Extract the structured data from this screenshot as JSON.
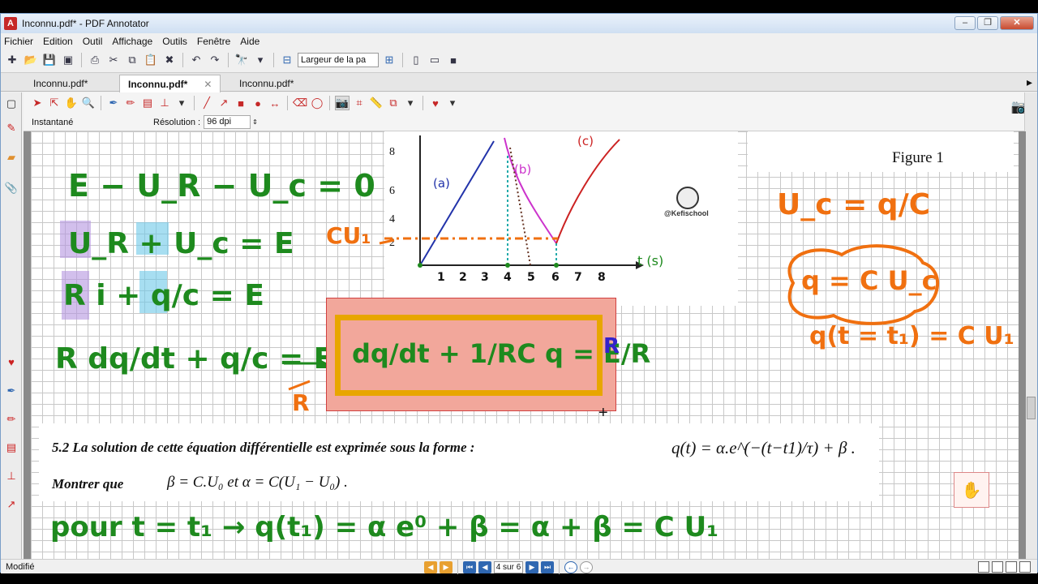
{
  "window": {
    "title": "Inconnu.pdf* - PDF Annotator",
    "app_icon": "pdf-annotator-icon"
  },
  "menu": [
    "Fichier",
    "Edition",
    "Outil",
    "Affichage",
    "Outils",
    "Fenêtre",
    "Aide"
  ],
  "toolbar": {
    "zoom_value": "Largeur de la pa"
  },
  "tabs": [
    {
      "label": "Inconnu.pdf*",
      "active": false
    },
    {
      "label": "Inconnu.pdf*",
      "active": true
    },
    {
      "label": "Inconnu.pdf*",
      "active": false
    }
  ],
  "tool_options": {
    "tool_name": "Instantané",
    "resolution_label": "Résolution :",
    "resolution_value": "96 dpi"
  },
  "document": {
    "figure_label": "Figure 1",
    "watermark": "@Kefischool",
    "graph_ticks_x": [
      "1",
      "2",
      "3",
      "4",
      "5",
      "6",
      "7",
      "8"
    ],
    "graph_ticks_y": [
      "8",
      "6",
      "4",
      "2"
    ],
    "graph_axis_label": "t (s)",
    "graph_curve_labels": [
      "(a)",
      "(b)",
      "(c)"
    ],
    "question_5_2_intro": "5.2 La solution de cette équation différentielle est exprimée sous la forme :",
    "question_5_2_formula": "q(t) = α.e^(−(t−t1)/τ) + β .",
    "question_5_2_task_prefix": "Montrer que",
    "question_5_2_task_formula": "β = C.U₀ et α = C(U₁ − U₀) ."
  },
  "annotations": {
    "eq1": "E − U_R − U_c = 0",
    "eq2": "U_R + U_c = E",
    "eq3": "R i + q/c = E",
    "eq4_left": "R dq/dt + q/c = E",
    "boxed_equation": "dq/dt + 1/RC q = E/R",
    "arrow_label": "R",
    "boxed_side_label": "R",
    "cu1_label": "CU₁",
    "uc_def": "U_c = q/C",
    "q_def": "q = C U_c",
    "q_t1": "q(t = t₁) = C U₁",
    "bottom_line": "pour t = t₁ → q(t₁) = α e⁰ + β = α + β = C U₁"
  },
  "status": {
    "text": "Modifié",
    "page_indicator": "4 sur 6"
  },
  "colors": {
    "annotation_green": "#1e8a1e",
    "annotation_orange": "#f07010",
    "accent_red": "#c62828",
    "box_fill": "#f2a79b",
    "box_border": "#e8a600"
  }
}
